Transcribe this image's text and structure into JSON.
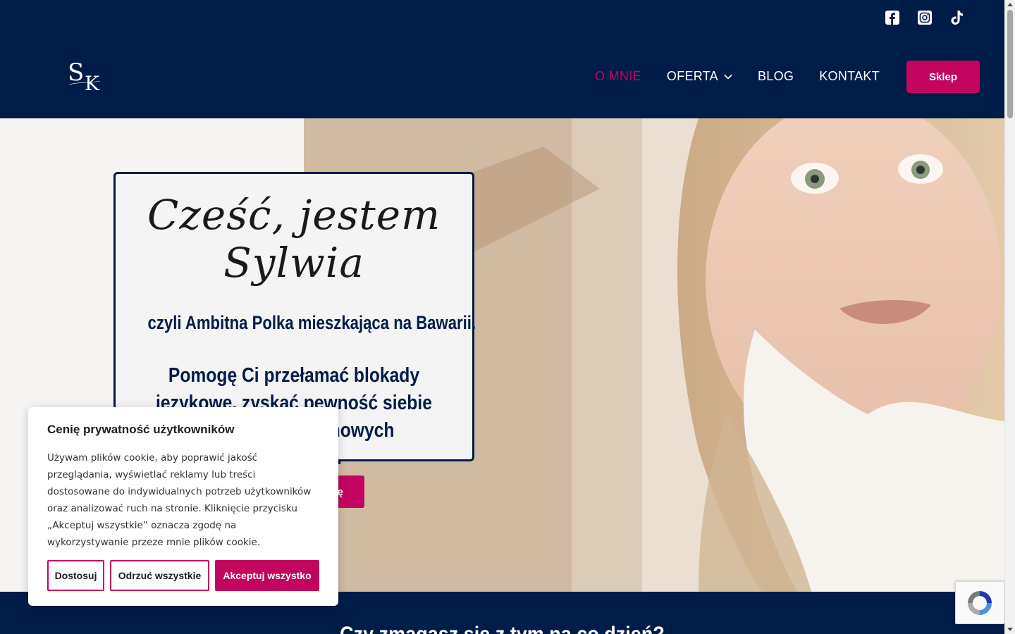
{
  "header": {
    "social": [
      {
        "name": "facebook-icon"
      },
      {
        "name": "instagram-icon"
      },
      {
        "name": "tiktok-icon"
      }
    ],
    "logo_text": "SK",
    "nav": {
      "about": "O MNIE",
      "offer": "OFERTA",
      "blog": "BLOG",
      "contact": "KONTAKT"
    },
    "shop_label": "Sklep"
  },
  "hero": {
    "script_title": "Cześć, jestem Sylwia",
    "subtitle": "czyli Ambitna Polka mieszkająca na Bawarii.",
    "description": "Pomogę Ci przełamać blokady językowe, zyskać pewność siebie i odnaleźć się w nowych warunkach.",
    "cta_visible": "ę"
  },
  "band": {
    "heading": "Czy zmagasz się z tym na co dzień?"
  },
  "cookie": {
    "title": "Cenię prywatność użytkowników",
    "text": "Używam plików cookie, aby poprawić jakość przeglądania, wyświetlać reklamy lub treści dostosowane do indywidualnych potrzeb użytkowników oraz analizować ruch na stronie. Kliknięcie przycisku „Akceptuj wszystkie” oznacza zgodę na wykorzystywanie przeze mnie plików cookie.",
    "customize": "Dostosuj",
    "reject": "Odrzuć wszystkie",
    "accept": "Akceptuj wszystko"
  },
  "colors": {
    "navy": "#001c48",
    "accent": "#c3055f"
  }
}
